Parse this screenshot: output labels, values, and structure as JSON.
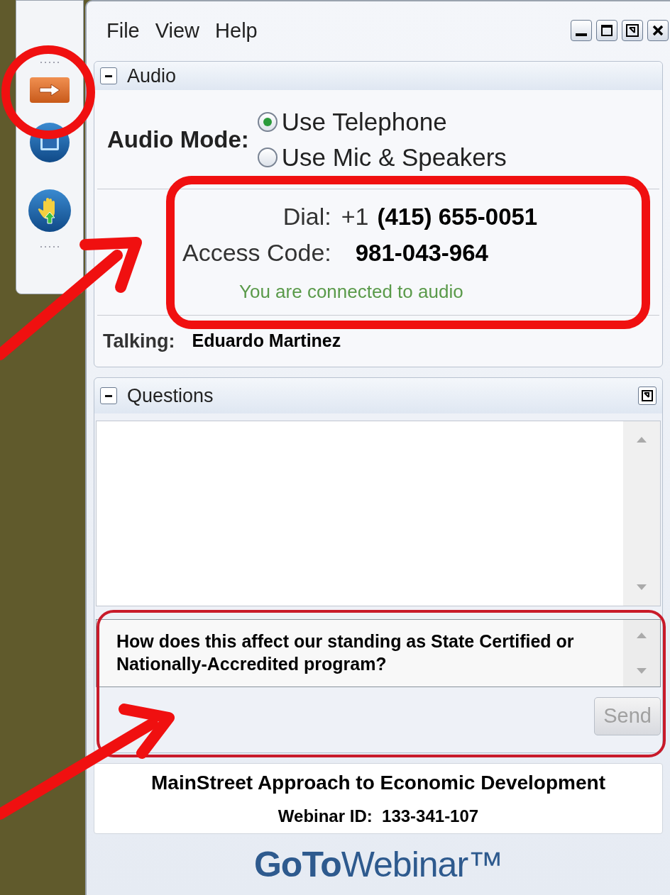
{
  "menu": [
    "File",
    "View",
    "Help"
  ],
  "audio": {
    "title": "Audio",
    "expanded": true,
    "mode_label": "Audio Mode:",
    "options": [
      {
        "label": "Use Telephone",
        "selected": true
      },
      {
        "label": "Use Mic & Speakers",
        "selected": false
      }
    ],
    "dial_label": "Dial:",
    "dial_prefix": "+1",
    "dial_number": "(415) 655-0051",
    "access_label": "Access Code:",
    "access_code": "981-043-964",
    "status": "You are connected to audio",
    "talking_label": "Talking:",
    "talking_name": "Eduardo Martinez"
  },
  "questions": {
    "title": "Questions",
    "expanded": true,
    "question": "How does this affect our standing as State Certified or Nationally-Accredited program?",
    "send": "Send",
    "send_disabled": true
  },
  "footer": {
    "title": "MainStreet Approach to Economic Development",
    "webinar_id": "Webinar ID:  133-341-107",
    "logo": "**GoTo**Webinar™"
  }
}
